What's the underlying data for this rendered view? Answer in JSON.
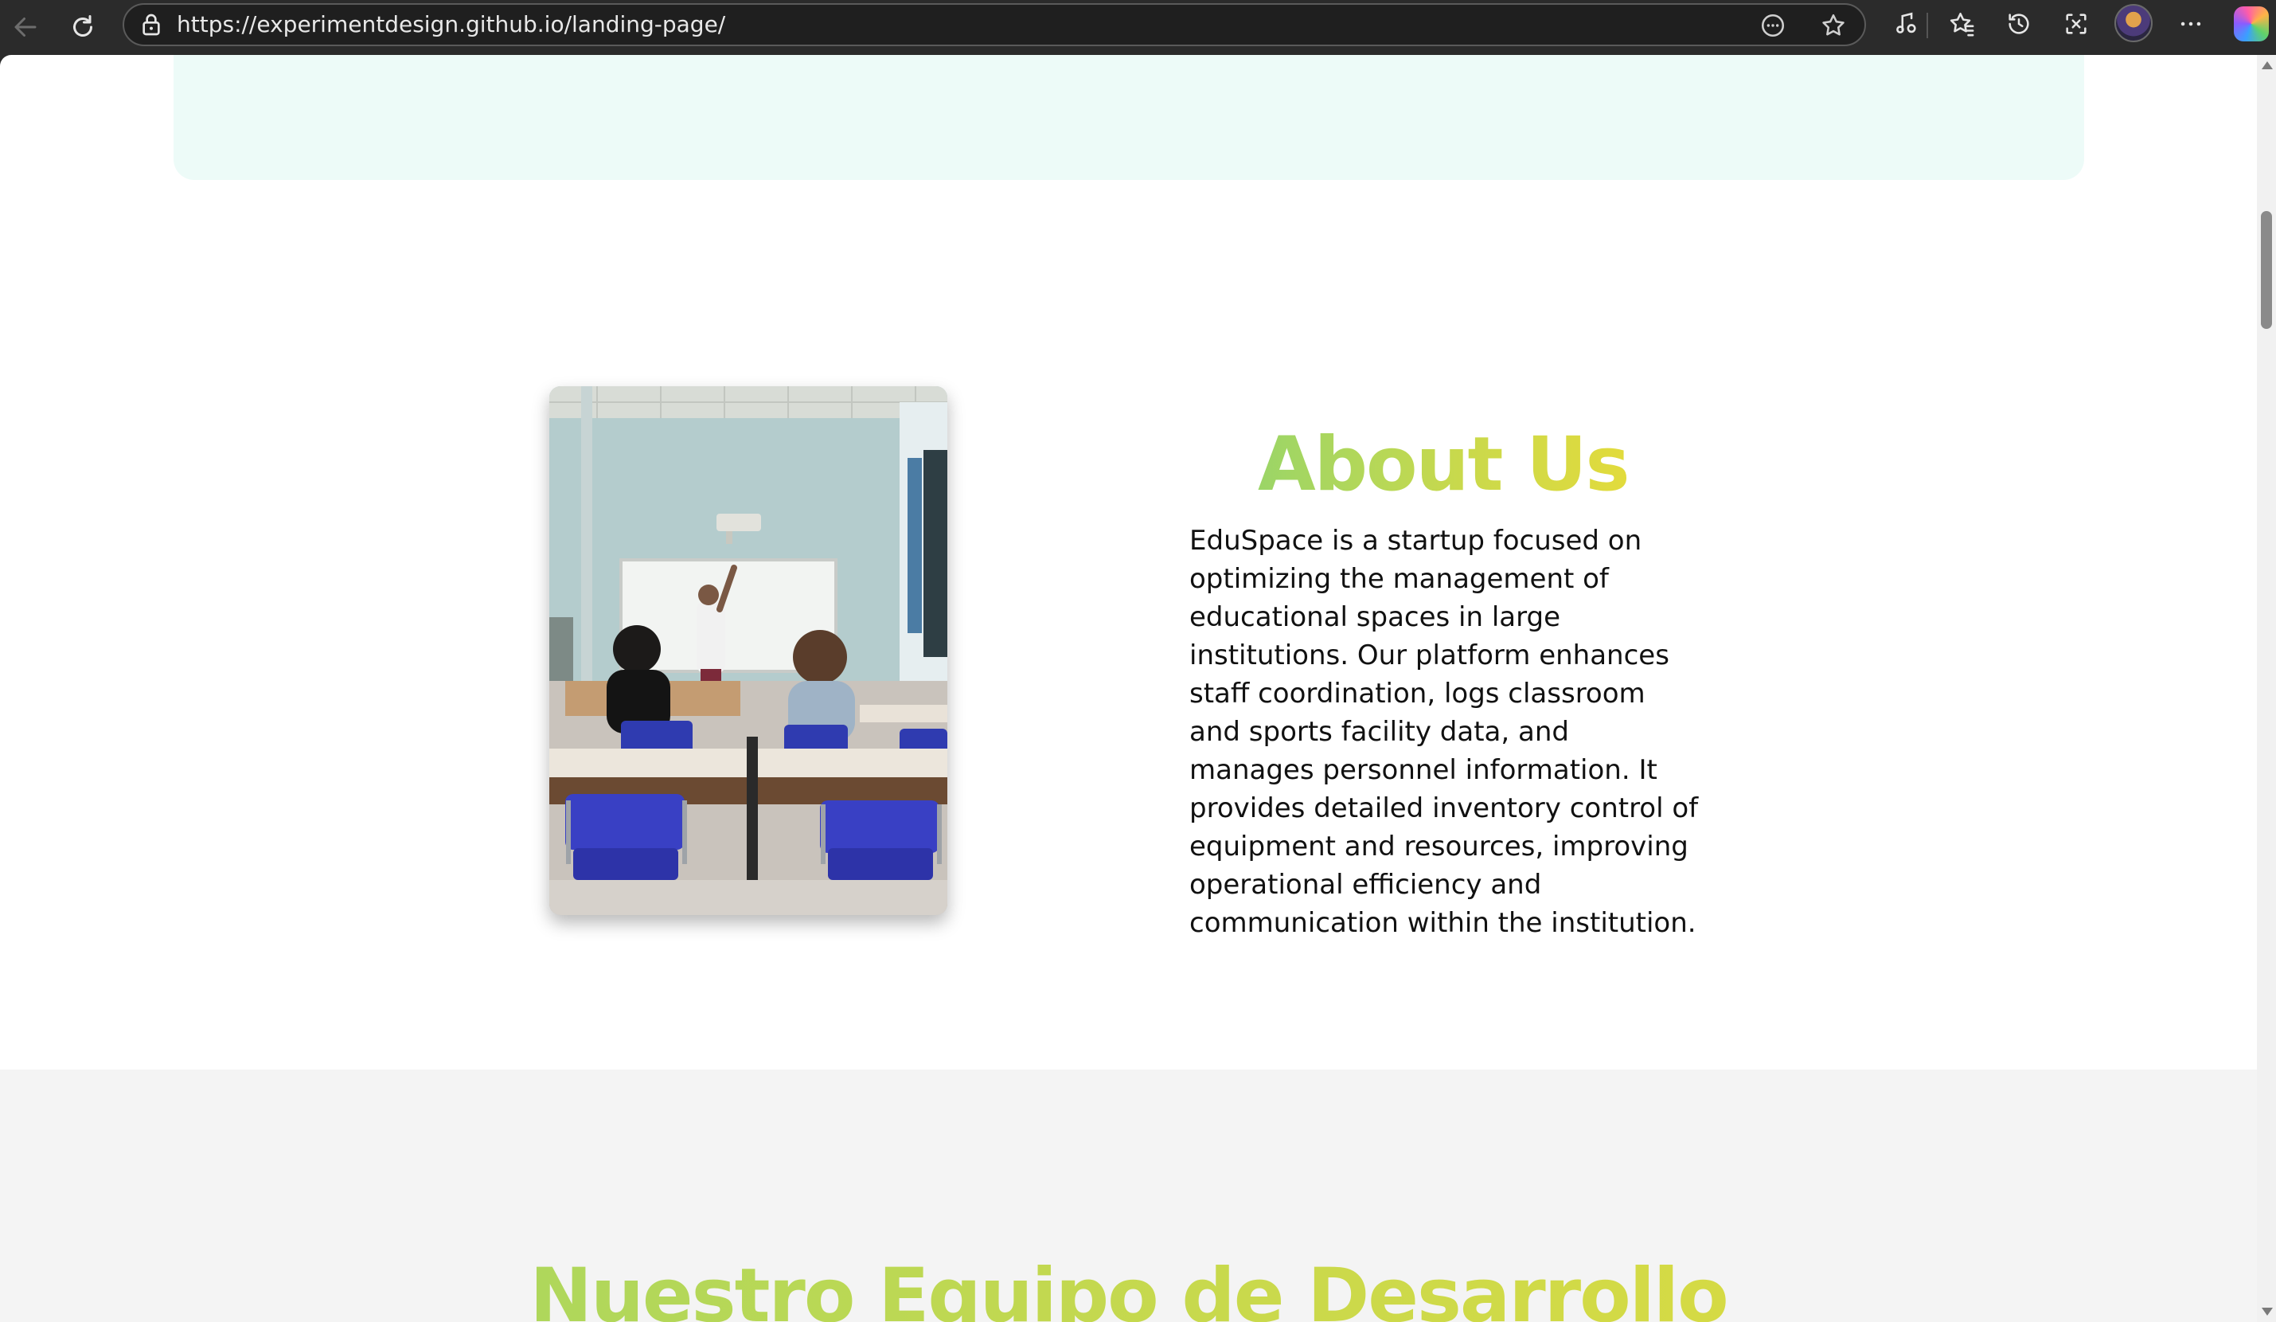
{
  "browser": {
    "url": "https://experimentdesign.github.io/landing-page/",
    "nav_icons": [
      "back-arrow-icon",
      "reload-icon"
    ],
    "address_icons": [
      "lock-icon",
      "read-aloud-icon",
      "favorite-star-icon"
    ],
    "toolbar_icons": [
      "media-control-icon",
      "favorites-icon",
      "history-icon",
      "screenshot-icon",
      "profile-avatar",
      "more-options-icon",
      "copilot-icon"
    ]
  },
  "about": {
    "title": "About Us",
    "paragraph": "EduSpace is a startup focused on optimizing the management of educational spaces in large institutions. Our platform enhances staff coordination, logs classroom and sports facility data, and manages personnel information. It provides detailed inventory control of equipment and resources, improving operational efficiency and communication within the institution.",
    "image_subject": "classroom-photo"
  },
  "team": {
    "title": "Nuestro Equipo de Desarrollo"
  },
  "colors": {
    "heading_gradient_start": "#9bd567",
    "heading_gradient_end": "#e2db3c",
    "hero_card_bg": "#edfbf8",
    "team_section_bg": "#f4f4f4",
    "body_text": "#111111"
  }
}
